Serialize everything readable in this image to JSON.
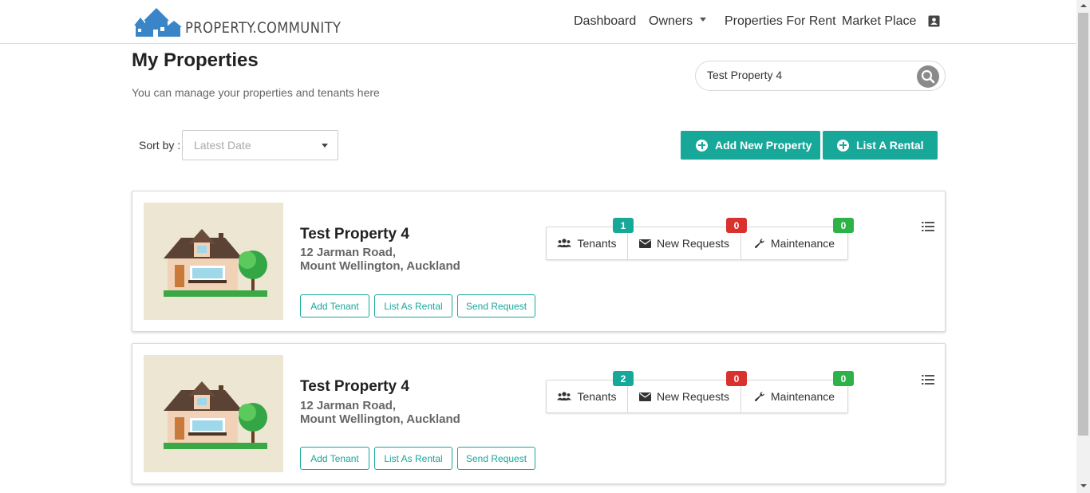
{
  "brand": {
    "name": "PROPERTY.COMMUNITY",
    "accent": "#17a89a",
    "logo_color": "#3a85c7"
  },
  "nav": {
    "items": [
      "Dashboard",
      "Owners",
      "Properties For Rent",
      "Market Place"
    ],
    "contact_icon": "contact-card-icon"
  },
  "page": {
    "title": "My Properties",
    "subtitle": "You can manage your properties and tenants here"
  },
  "search": {
    "value": "Test Property 4",
    "icon": "search-icon"
  },
  "sort": {
    "label": "Sort by :",
    "selected": "Latest Date"
  },
  "actions": {
    "add_property": "Add New Property",
    "list_rental": "List A Rental"
  },
  "properties": [
    {
      "name": "Test Property 4",
      "address_line1": "12 Jarman Road,",
      "address_line2": "Mount Wellington, Auckland",
      "stats": {
        "tenants": {
          "label": "Tenants",
          "count": "1",
          "color": "#17a89a"
        },
        "requests": {
          "label": "New Requests",
          "count": "0",
          "color": "#d9312d"
        },
        "maintenance": {
          "label": "Maintenance",
          "count": "0",
          "color": "#2db24a"
        }
      },
      "buttons": {
        "add_tenant": "Add Tenant",
        "list_rental": "List As Rental",
        "send_request": "Send Request"
      }
    },
    {
      "name": "Test Property 4",
      "address_line1": "12 Jarman Road,",
      "address_line2": "Mount Wellington, Auckland",
      "stats": {
        "tenants": {
          "label": "Tenants",
          "count": "2",
          "color": "#17a89a"
        },
        "requests": {
          "label": "New Requests",
          "count": "0",
          "color": "#d9312d"
        },
        "maintenance": {
          "label": "Maintenance",
          "count": "0",
          "color": "#2db24a"
        }
      },
      "buttons": {
        "add_tenant": "Add Tenant",
        "list_rental": "List As Rental",
        "send_request": "Send Request"
      }
    }
  ]
}
